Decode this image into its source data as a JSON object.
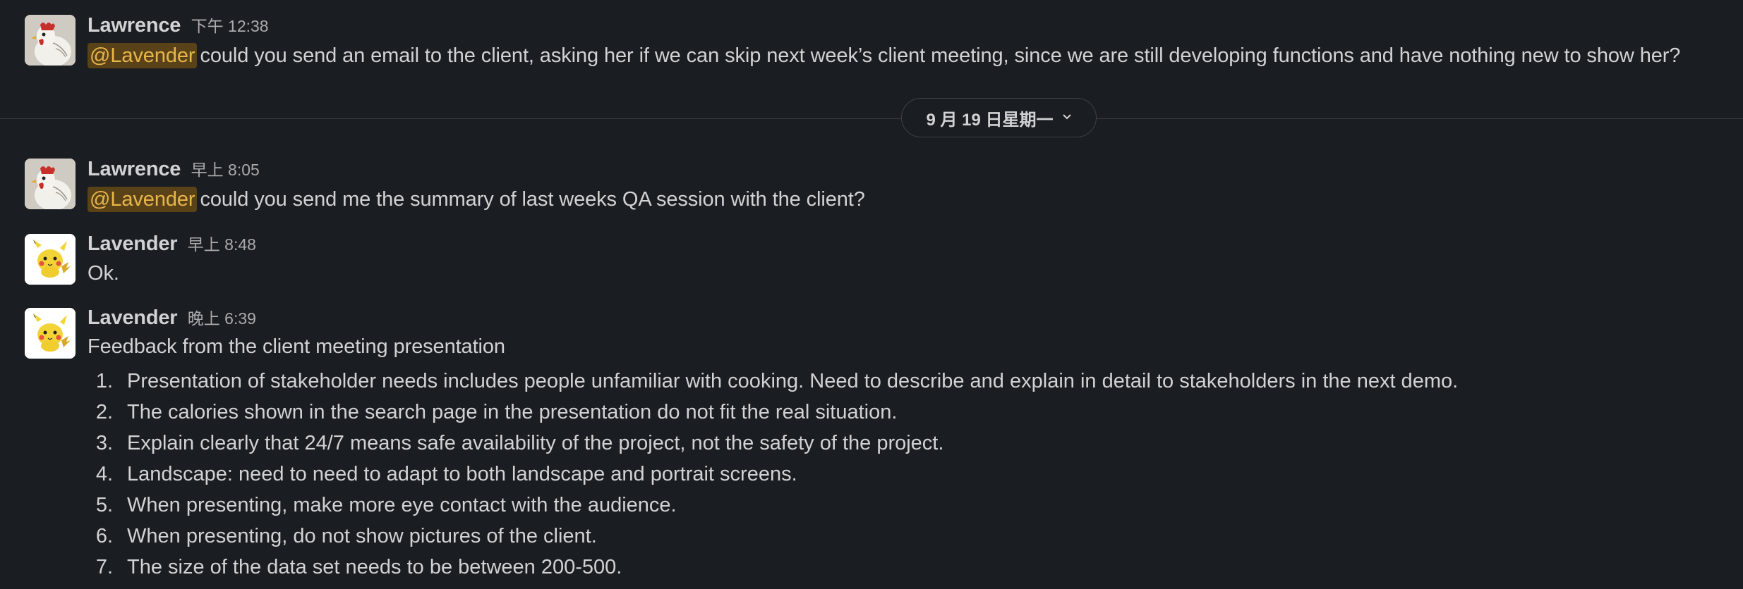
{
  "messages": [
    {
      "author": "Lawrence",
      "time": "下午 12:38",
      "avatar": "rooster-avatar",
      "mention": "@Lavender",
      "text": "could you send an email to the client, asking her if we can skip next week’s client meeting, since we are still developing functions and have nothing new to show her?"
    },
    {
      "author": "Lawrence",
      "time": "早上 8:05",
      "avatar": "rooster-avatar",
      "mention": "@Lavender",
      "text": "could you send me the summary of last weeks QA session with the client?"
    },
    {
      "author": "Lavender",
      "time": "早上 8:48",
      "avatar": "pikachu-avatar",
      "text": "Ok."
    },
    {
      "author": "Lavender",
      "time": "晚上 6:39",
      "avatar": "pikachu-avatar",
      "text": "Feedback from the client meeting presentation",
      "list": [
        {
          "num": "1.",
          "text": "Presentation of stakeholder needs includes people unfamiliar with cooking. Need to describe and explain in detail to stakeholders in the next demo."
        },
        {
          "num": "2.",
          "text": "The calories shown in the search page in the presentation do not fit the real situation."
        },
        {
          "num": "3.",
          "text": "Explain clearly that 24/7 means safe availability of the project, not the safety of the project."
        },
        {
          "num": "4.",
          "text": "Landscape: need to need to adapt to both landscape and portrait screens."
        },
        {
          "num": "5.",
          "text": "When presenting, make more eye contact with the audience."
        },
        {
          "num": "6.",
          "text": "When presenting, do not show pictures of the client."
        },
        {
          "num": "7.",
          "text": "The size of the data set needs to be between 200-500."
        }
      ]
    }
  ],
  "date_divider": {
    "label": "9 月 19 日星期一",
    "icon": "chevron-down-icon"
  },
  "colors": {
    "background": "#1a1d21",
    "text": "#d1d2d3",
    "timestamp": "#ababad",
    "mention_bg": "#5a4218",
    "mention_text": "#e8b54a"
  }
}
